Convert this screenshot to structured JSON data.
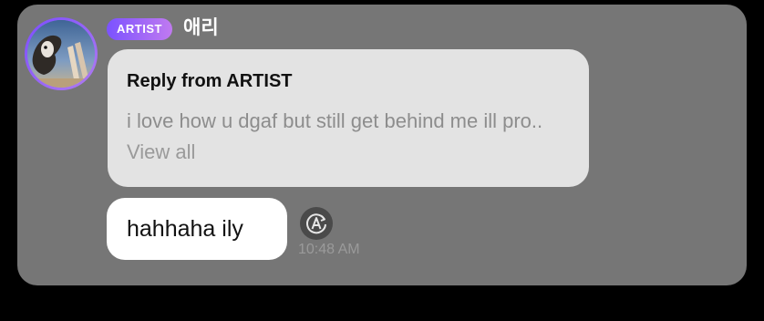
{
  "message": {
    "badge": "ARTIST",
    "username": "애리",
    "reply": {
      "title": "Reply from ARTIST",
      "text": "i love how u dgaf but still get behind me ill pro..",
      "view_all": "View all"
    },
    "text": "hahhaha ily",
    "time": "10:48 AM"
  },
  "icons": {
    "avatar": "avatar-image",
    "translate": "translate-icon"
  },
  "colors": {
    "background": "#000000",
    "card": "#767676",
    "reply_bubble": "#e3e3e3",
    "message_bubble": "#ffffff",
    "badge_start": "#7b52ff",
    "badge_end": "#c07af0"
  }
}
